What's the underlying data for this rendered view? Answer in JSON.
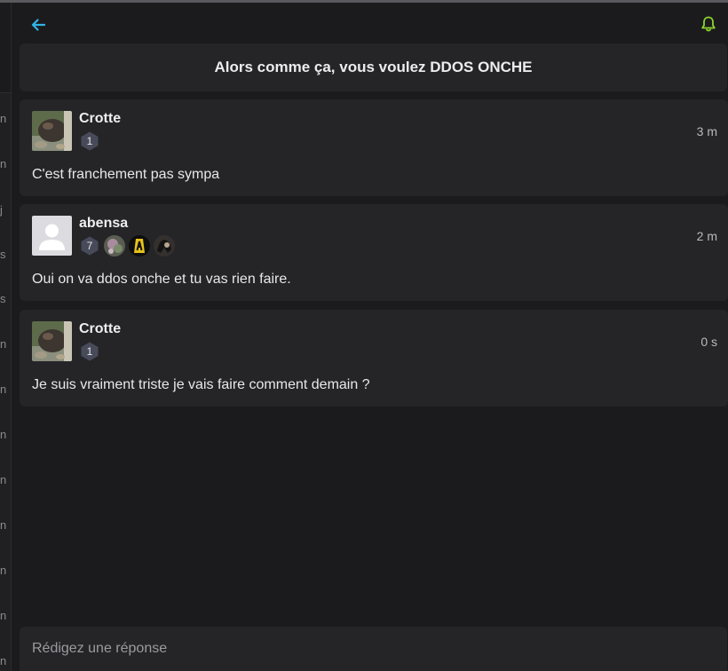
{
  "topic": {
    "title": "Alors comme ça, vous voulez DDOS ONCHE"
  },
  "sidebar_fragments": [
    "n",
    "n",
    "j",
    "s",
    "s",
    "n",
    "n",
    "n",
    "n",
    "n",
    "n",
    "n",
    "n"
  ],
  "colors": {
    "accent": "#2fb4e6",
    "notification": "#8cd42c",
    "card": "#252528",
    "background": "#1b1b1d"
  },
  "icons": {
    "back": "arrow-left-icon",
    "notifications": "bell-icon"
  },
  "posts": [
    {
      "author": "Crotte",
      "level": "1",
      "time": "3 m",
      "message": "C'est franchement pas sympa",
      "badges": []
    },
    {
      "author": "abensa",
      "level": "7",
      "time": "2 m",
      "message": "Oui on va ddos onche et tu vas rien faire.",
      "badges": [
        "badge-1",
        "badge-2",
        "badge-3"
      ]
    },
    {
      "author": "Crotte",
      "level": "1",
      "time": "0 s",
      "message": "Je suis vraiment triste je vais faire comment demain ?",
      "badges": []
    }
  ],
  "reply": {
    "placeholder": "Rédigez une réponse",
    "value": ""
  }
}
